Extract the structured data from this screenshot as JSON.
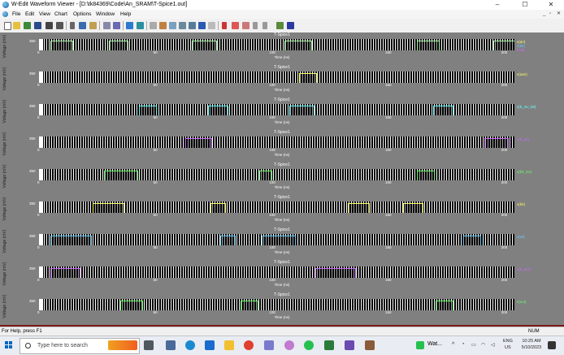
{
  "window": {
    "title": "W-Edit Waveform Viewer - [D:\\tk84369\\Code\\An_SRAM\\T-Spice1.out]",
    "minimize": "–",
    "maximize": "☐",
    "close": "✕"
  },
  "menu": [
    "File",
    "Edit",
    "View",
    "Chart",
    "Options",
    "Window",
    "Help"
  ],
  "mdi_controls": [
    "_",
    "▫",
    "✕"
  ],
  "panels": [
    {
      "legend": [
        "v(an)",
        "v(bit)",
        "v(wl)"
      ],
      "legend_colors": [
        "#ffff66",
        "#66ccff",
        "#cc66ff"
      ],
      "color": "#aaffaa",
      "pulses": [
        [
          5,
          14
        ],
        [
          30,
          38
        ],
        [
          66,
          76
        ],
        [
          106,
          117
        ],
        [
          163,
          172
        ],
        [
          196,
          205
        ]
      ]
    },
    {
      "legend": [
        "v(aan)"
      ],
      "legend_colors": [
        "#ffff66"
      ],
      "color": "#ffff66",
      "pulses": [
        [
          112,
          119
        ]
      ]
    },
    {
      "legend": [
        "v(b_inv_bit)"
      ],
      "legend_colors": [
        "#66ffff"
      ],
      "color": "#66ffff",
      "pulses": [
        [
          43,
          50
        ],
        [
          73,
          81
        ],
        [
          108,
          118
        ],
        [
          170,
          178
        ]
      ]
    },
    {
      "legend": [
        "v(b_an)"
      ],
      "legend_colors": [
        "#cc66ff"
      ],
      "color": "#cc66ff",
      "pulses": [
        [
          63,
          74
        ],
        [
          192,
          202
        ]
      ]
    },
    {
      "legend": [
        "v(bit_inv)"
      ],
      "legend_colors": [
        "#66ff66"
      ],
      "color": "#66ff66",
      "pulses": [
        [
          28,
          42
        ],
        [
          95,
          100
        ],
        [
          163,
          170
        ]
      ]
    },
    {
      "legend": [
        "v(bit)"
      ],
      "legend_colors": [
        "#ffff66"
      ],
      "color": "#ffff66",
      "pulses": [
        [
          23,
          36
        ],
        [
          74,
          80
        ],
        [
          133,
          142
        ],
        [
          157,
          165
        ]
      ]
    },
    {
      "legend": [
        "v(wl)"
      ],
      "legend_colors": [
        "#66ccff"
      ],
      "color": "#66ccff",
      "pulses": [
        [
          5,
          22
        ],
        [
          78,
          84
        ],
        [
          96,
          110
        ],
        [
          183,
          190
        ]
      ]
    },
    {
      "legend": [
        "v(b_an2)"
      ],
      "legend_colors": [
        "#cc66ff"
      ],
      "color": "#cc66ff",
      "pulses": [
        [
          5,
          17
        ],
        [
          119,
          136
        ]
      ]
    },
    {
      "legend": [
        "v(out)"
      ],
      "legend_colors": [
        "#66ff66"
      ],
      "color": "#66ff66",
      "pulses": [
        [
          35,
          44
        ],
        [
          87,
          94
        ],
        [
          171,
          178
        ]
      ]
    }
  ],
  "chart_data": {
    "type": "line",
    "title": "T-Spice1",
    "xlabel": "Time (ns)",
    "ylabel": "Voltage (mV)",
    "xlim": [
      0,
      205
    ],
    "xticks": [
      "0",
      "50",
      "100",
      "150",
      "200"
    ],
    "yticks": [
      "350"
    ],
    "series": [
      {
        "name": "v(an)"
      },
      {
        "name": "v(aan)"
      },
      {
        "name": "v(b_inv_bit)"
      },
      {
        "name": "v(b_an)"
      },
      {
        "name": "v(bit_inv)"
      },
      {
        "name": "v(bit)"
      },
      {
        "name": "v(wl)"
      },
      {
        "name": "v(b_an2)"
      },
      {
        "name": "v(out)"
      }
    ]
  },
  "status": {
    "help": "For Help, press F1",
    "mode": "NUM"
  },
  "taskbar": {
    "search_placeholder": "Type here to search",
    "app_label": "Wat...",
    "lang_top": "ENG",
    "lang_bottom": "US",
    "time": "10:25 AM",
    "date": "5/10/2023"
  }
}
